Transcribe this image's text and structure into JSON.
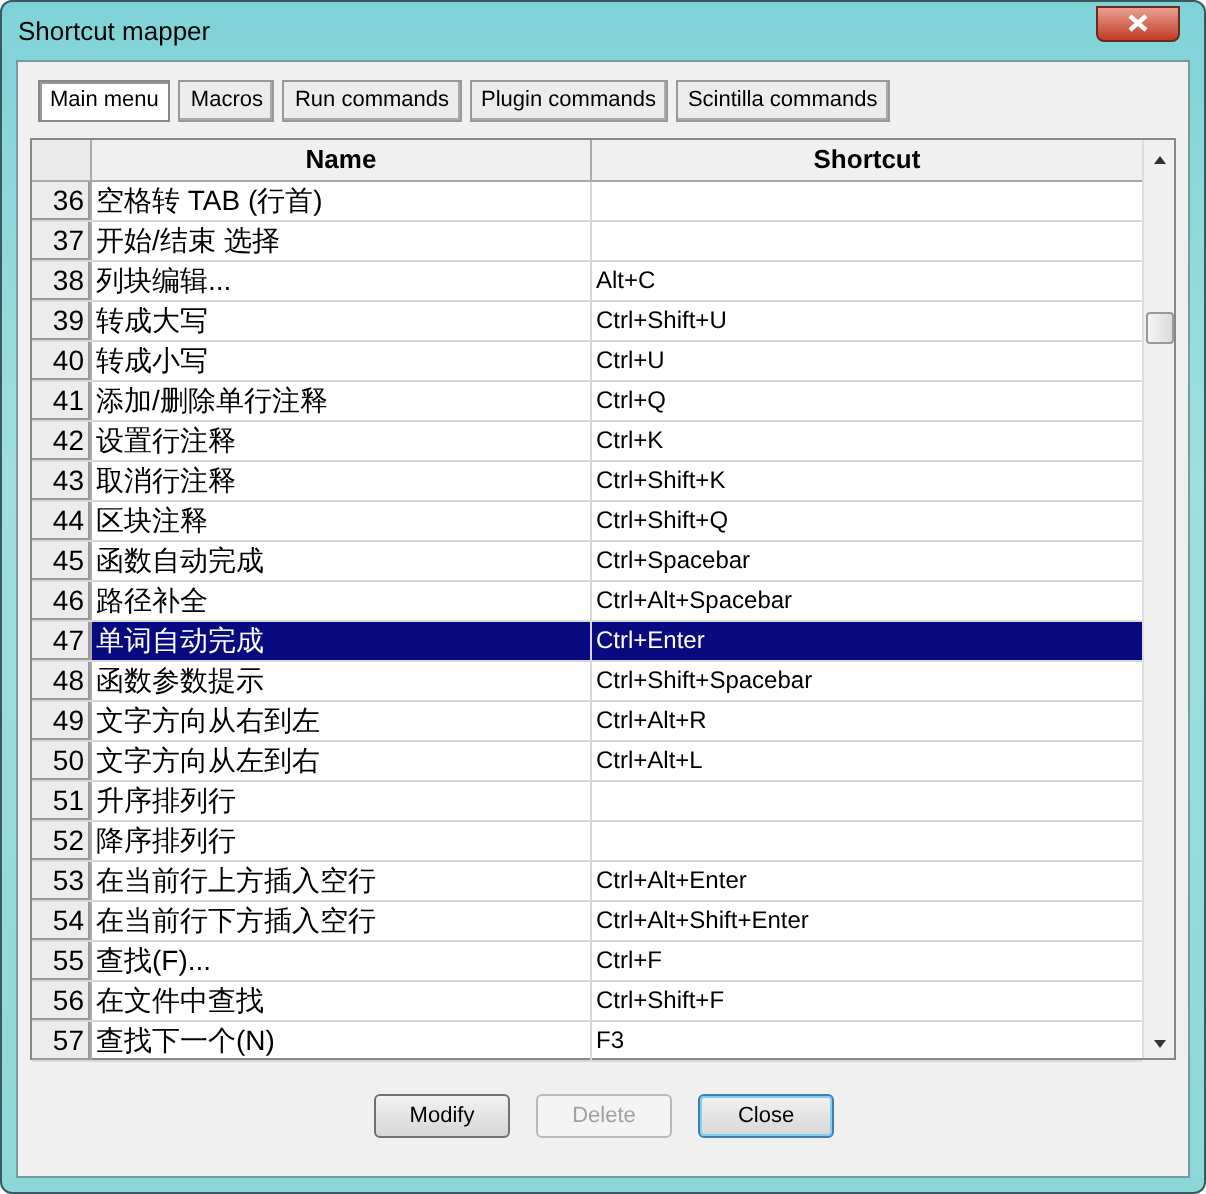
{
  "window": {
    "title": "Shortcut mapper"
  },
  "tabs": [
    {
      "label": "Main menu",
      "selected": true
    },
    {
      "label": "Macros",
      "selected": false
    },
    {
      "label": "Run commands",
      "selected": false
    },
    {
      "label": "Plugin commands",
      "selected": false
    },
    {
      "label": "Scintilla commands",
      "selected": false
    }
  ],
  "table": {
    "columns": [
      "Name",
      "Shortcut"
    ],
    "rows": [
      {
        "number": "36",
        "name": "空格转 TAB (行首)",
        "shortcut": "",
        "selected": false
      },
      {
        "number": "37",
        "name": "开始/结束 选择",
        "shortcut": "",
        "selected": false
      },
      {
        "number": "38",
        "name": "列块编辑...",
        "shortcut": "Alt+C",
        "selected": false
      },
      {
        "number": "39",
        "name": "转成大写",
        "shortcut": "Ctrl+Shift+U",
        "selected": false
      },
      {
        "number": "40",
        "name": "转成小写",
        "shortcut": "Ctrl+U",
        "selected": false
      },
      {
        "number": "41",
        "name": "添加/删除单行注释",
        "shortcut": "Ctrl+Q",
        "selected": false
      },
      {
        "number": "42",
        "name": "设置行注释",
        "shortcut": "Ctrl+K",
        "selected": false
      },
      {
        "number": "43",
        "name": "取消行注释",
        "shortcut": "Ctrl+Shift+K",
        "selected": false
      },
      {
        "number": "44",
        "name": "区块注释",
        "shortcut": "Ctrl+Shift+Q",
        "selected": false
      },
      {
        "number": "45",
        "name": "函数自动完成",
        "shortcut": "Ctrl+Spacebar",
        "selected": false
      },
      {
        "number": "46",
        "name": "路径补全",
        "shortcut": "Ctrl+Alt+Spacebar",
        "selected": false
      },
      {
        "number": "47",
        "name": "单词自动完成",
        "shortcut": "Ctrl+Enter",
        "selected": true
      },
      {
        "number": "48",
        "name": "函数参数提示",
        "shortcut": "Ctrl+Shift+Spacebar",
        "selected": false
      },
      {
        "number": "49",
        "name": "文字方向从右到左",
        "shortcut": "Ctrl+Alt+R",
        "selected": false
      },
      {
        "number": "50",
        "name": "文字方向从左到右",
        "shortcut": "Ctrl+Alt+L",
        "selected": false
      },
      {
        "number": "51",
        "name": "升序排列行",
        "shortcut": "",
        "selected": false
      },
      {
        "number": "52",
        "name": "降序排列行",
        "shortcut": "",
        "selected": false
      },
      {
        "number": "53",
        "name": "在当前行上方插入空行",
        "shortcut": "Ctrl+Alt+Enter",
        "selected": false
      },
      {
        "number": "54",
        "name": "在当前行下方插入空行",
        "shortcut": "Ctrl+Alt+Shift+Enter",
        "selected": false
      },
      {
        "number": "55",
        "name": "查找(F)...",
        "shortcut": "Ctrl+F",
        "selected": false
      },
      {
        "number": "56",
        "name": "在文件中查找",
        "shortcut": "Ctrl+Shift+F",
        "selected": false
      },
      {
        "number": "57",
        "name": "查找下一个(N)",
        "shortcut": "F3",
        "selected": false
      }
    ]
  },
  "buttons": [
    {
      "label": "Modify",
      "disabled": false,
      "selected": false
    },
    {
      "label": "Delete",
      "disabled": true,
      "selected": false
    },
    {
      "label": "Close",
      "disabled": false,
      "selected": true
    }
  ]
}
